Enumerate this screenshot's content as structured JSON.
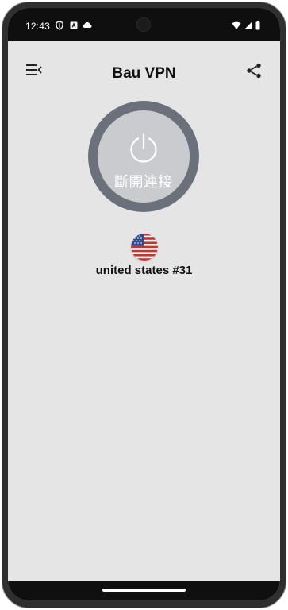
{
  "status_bar": {
    "time": "12:43"
  },
  "header": {
    "title": "Bau VPN",
    "menu_icon": "menu-collapse-icon",
    "share_icon": "share-icon"
  },
  "connection": {
    "button_label": "斷開連接",
    "power_icon": "power-icon"
  },
  "server": {
    "name": "united states #31",
    "flag_icon": "us-flag-icon"
  },
  "colors": {
    "background": "#e5e5e5",
    "ring": "#6b717a",
    "button_fill": "#c9cbcf",
    "status_bar": "#0f0f10"
  }
}
